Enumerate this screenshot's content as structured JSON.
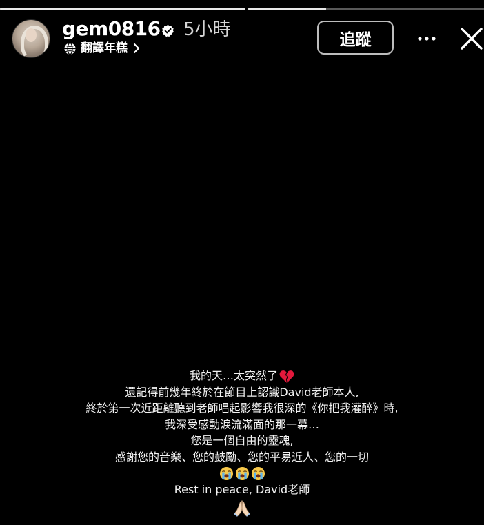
{
  "story": {
    "progress": [
      {
        "fill_fraction": 1.0
      },
      {
        "fill_fraction": 0.33
      }
    ]
  },
  "header": {
    "username": "gem0816",
    "verified": true,
    "time": "5小時",
    "translate_label": "翻譯年糕",
    "follow_label": "追蹤",
    "icons": {
      "verified": "verified-badge-icon",
      "translate": "globe-icon",
      "chevron": "chevron-right-icon",
      "more": "more-dots-icon",
      "close": "close-icon"
    }
  },
  "caption": {
    "lines": [
      "我的天…太突然了",
      "還記得前幾年終於在節目上認識David老師本人,",
      "終於第一次近距離聽到老師唱起影響我很深的《你把我灌醉》時,",
      "我深受感動淚流滿面的那一幕…",
      "您是一個自由的靈魂,",
      "感謝您的音樂、您的鼓勵、您的平易近人、您的一切",
      "Rest in peace, David老師"
    ],
    "emojis": {
      "line1_end": "broken-heart-icon",
      "crying_row": [
        "loudly-crying-face-icon",
        "loudly-crying-face-icon",
        "loudly-crying-face-icon"
      ],
      "final": "folded-hands-icon"
    }
  },
  "colors": {
    "background": "#000000",
    "text": "#ffffff",
    "muted_text": "#d6d6d6",
    "button_border": "#bdbdbd",
    "progress_fill": "#e8e8e8"
  }
}
